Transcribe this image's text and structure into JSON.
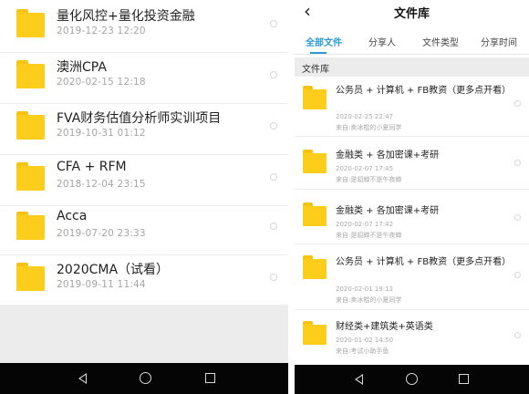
{
  "left_screen": {
    "files": [
      {
        "name": "量化风控+量化投资金融",
        "date": "2019-12-23  12:20"
      },
      {
        "name": "澳洲CPA",
        "date": "2020-02-15  12:18"
      },
      {
        "name": "FVA财务估值分析师实训项目",
        "date": "2019-10-31  01:12"
      },
      {
        "name": "CFA + RFM",
        "date": "2018-12-04  23:15"
      },
      {
        "name": "Acca",
        "date": "2019-07-20  23:33"
      },
      {
        "name": "2020CMA（试看）",
        "date": "2019-09-11  11:44"
      }
    ]
  },
  "right_screen": {
    "back_symbol": "‹",
    "title": "文件库",
    "tabs": [
      {
        "label": "全部文件",
        "active": true
      },
      {
        "label": "分享人",
        "active": false
      },
      {
        "label": "文件类型",
        "active": false
      },
      {
        "label": "分享时间",
        "active": false
      }
    ],
    "section_label": "文件库",
    "files": [
      {
        "name": "公务员 + 计算机 + FB教资（更多点开看）",
        "date": "2020-02-25  22:47",
        "from": "来自:卖冰棍的小夏同学"
      },
      {
        "name": "金融类 + 各加密课+考研",
        "date": "2020-02-07  17:45",
        "from": "来自:是貂蝉不是午夜蝉"
      },
      {
        "name": "金融类 + 各加密课+考研",
        "date": "2020-02-07  17:42",
        "from": "来自:是貂蝉不是午夜蝉"
      },
      {
        "name": "公务员 + 计算机 + FB教资（更多点开看）",
        "date": "2020-02-01  19:12",
        "from": "来自:卖冰棍的小夏同学"
      },
      {
        "name": "财经类+建筑类+英语类",
        "date": "2020-01-02  14:50",
        "from": "来自:考试小助手鱼"
      }
    ]
  },
  "colors": {
    "folder": "#fccd1b",
    "accent": "#2f9bd6",
    "navbar": "#050505"
  },
  "icons": {
    "folder": "folder-icon",
    "select": "radio-circle-icon",
    "nav_back": "triangle-back-icon",
    "nav_home": "circle-home-icon",
    "nav_recent": "square-recent-icon"
  }
}
